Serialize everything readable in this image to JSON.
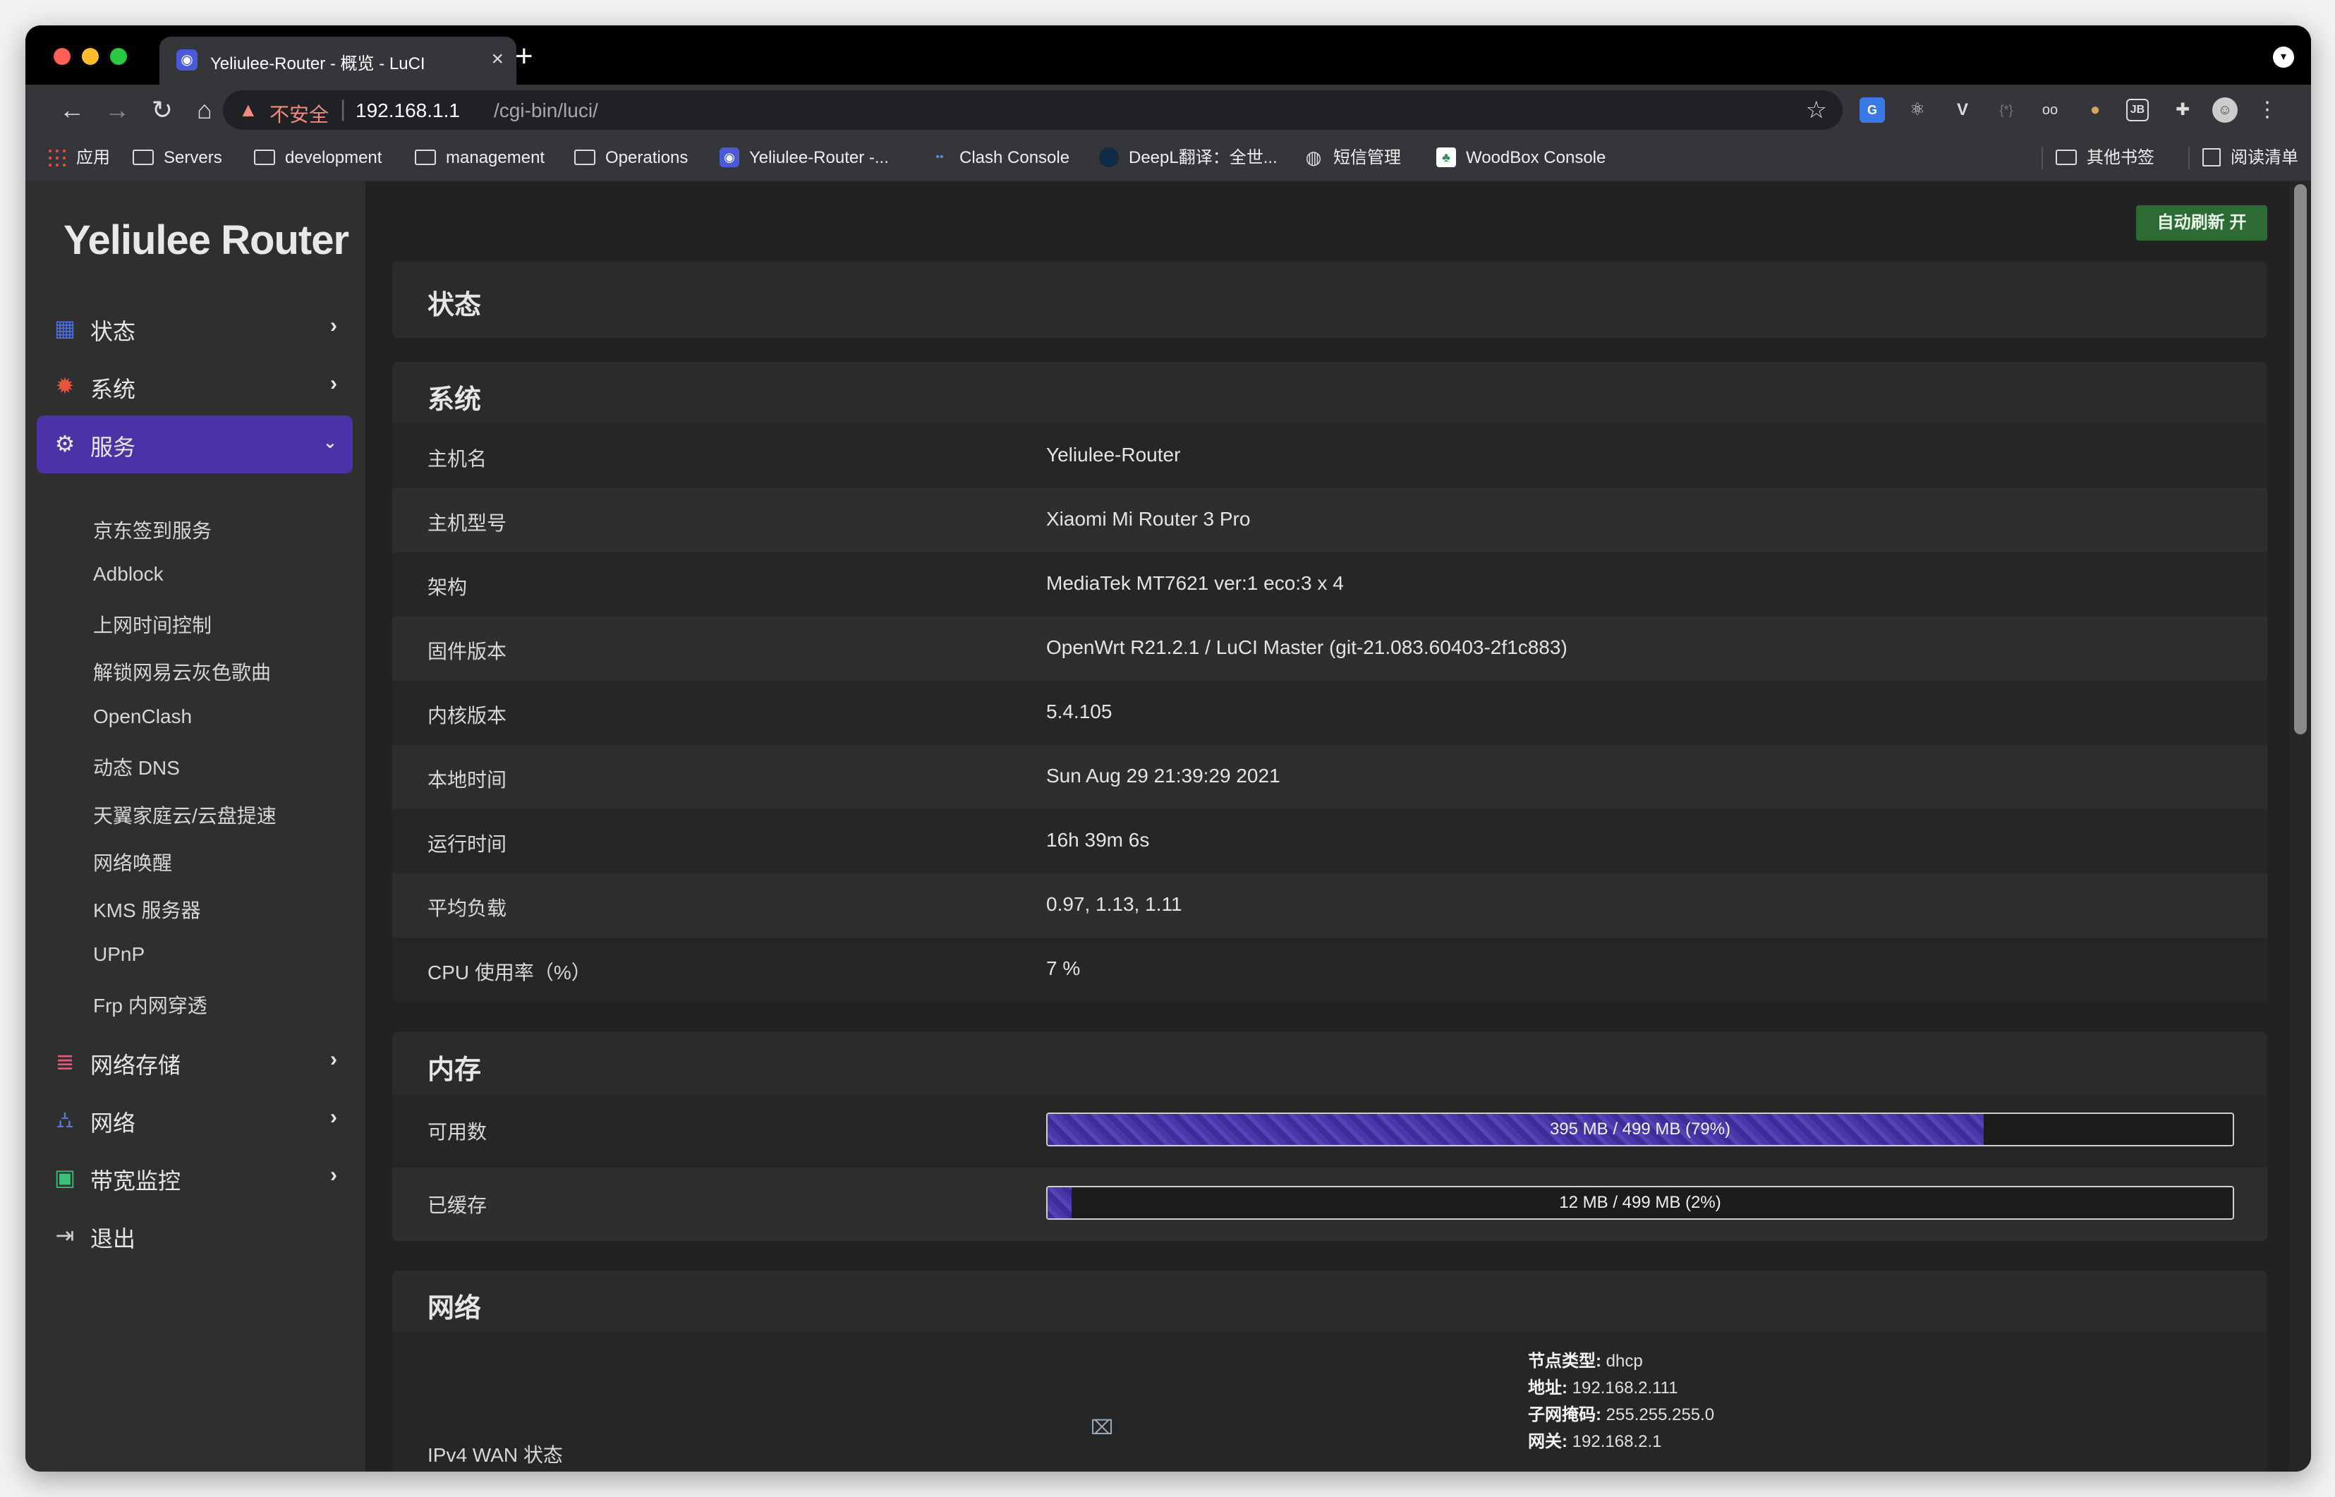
{
  "browser": {
    "tab": {
      "title": "Yeliulee-Router - 概览 - LuCI",
      "favicon": "github-icon"
    },
    "address": {
      "insecure_label": "不安全",
      "host": "192.168.1.1",
      "path": "/cgi-bin/luci/"
    },
    "bookmarks": [
      {
        "label": "应用",
        "icon": "apps-grid-icon"
      },
      {
        "label": "Servers",
        "icon": "folder-icon"
      },
      {
        "label": "development",
        "icon": "folder-icon"
      },
      {
        "label": "management",
        "icon": "folder-icon"
      },
      {
        "label": "Operations",
        "icon": "folder-icon"
      },
      {
        "label": "Yeliulee-Router -...",
        "icon": "github-icon"
      },
      {
        "label": "Clash Console",
        "icon": "clash-icon"
      },
      {
        "label": "DeepL翻译：全世...",
        "icon": "deepl-icon"
      },
      {
        "label": "短信管理",
        "icon": "globe-icon"
      },
      {
        "label": "WoodBox Console",
        "icon": "woodbox-icon"
      },
      {
        "label": "其他书签",
        "icon": "folder-icon"
      },
      {
        "label": "阅读清单",
        "icon": "reading-list-icon"
      }
    ]
  },
  "sidebar": {
    "brand": "Yeliulee Router",
    "menu": [
      {
        "label": "状态",
        "icon": "dashboard-icon"
      },
      {
        "label": "系统",
        "icon": "gear-icon"
      },
      {
        "label": "服务",
        "icon": "services-gears-icon",
        "active": true
      },
      {
        "label": "网络存储",
        "icon": "database-icon"
      },
      {
        "label": "网络",
        "icon": "network-tree-icon"
      },
      {
        "label": "带宽监控",
        "icon": "monitor-icon"
      },
      {
        "label": "退出",
        "icon": "logout-icon"
      }
    ],
    "services_submenu": [
      "京东签到服务",
      "Adblock",
      "上网时间控制",
      "解锁网易云灰色歌曲",
      "OpenClash",
      "动态 DNS",
      "天翼家庭云/云盘提速",
      "网络唤醒",
      "KMS 服务器",
      "UPnP",
      "Frp 内网穿透"
    ]
  },
  "content": {
    "autorefresh_button": "自动刷新 开",
    "page_title": "状态",
    "system": {
      "title": "系统",
      "rows": [
        {
          "key": "主机名",
          "value": "Yeliulee-Router"
        },
        {
          "key": "主机型号",
          "value": "Xiaomi Mi Router 3 Pro"
        },
        {
          "key": "架构",
          "value": "MediaTek MT7621 ver:1 eco:3 x 4"
        },
        {
          "key": "固件版本",
          "value": "OpenWrt R21.2.1 / LuCI Master (git-21.083.60403-2f1c883)"
        },
        {
          "key": "内核版本",
          "value": "5.4.105"
        },
        {
          "key": "本地时间",
          "value": "Sun Aug 29 21:39:29 2021"
        },
        {
          "key": "运行时间",
          "value": "16h 39m 6s"
        },
        {
          "key": "平均负载",
          "value": "0.97, 1.13, 1.11"
        },
        {
          "key": "CPU 使用率（%）",
          "value": "7 %"
        }
      ]
    },
    "memory": {
      "title": "内存",
      "rows": [
        {
          "key": "可用数",
          "label": "395 MB / 499 MB (79%)",
          "fraction": 0.79
        },
        {
          "key": "已缓存",
          "label": "12 MB / 499 MB (2%)",
          "fraction": 0.02
        }
      ]
    },
    "network": {
      "title": "网络",
      "wan_label": "IPv4 WAN 状态",
      "wan_details": [
        {
          "k": "节点类型:",
          "v": "dhcp"
        },
        {
          "k": "地址:",
          "v": "192.168.2.111"
        },
        {
          "k": "子网掩码:",
          "v": "255.255.255.0"
        },
        {
          "k": "网关:",
          "v": "192.168.2.1"
        }
      ]
    }
  }
}
